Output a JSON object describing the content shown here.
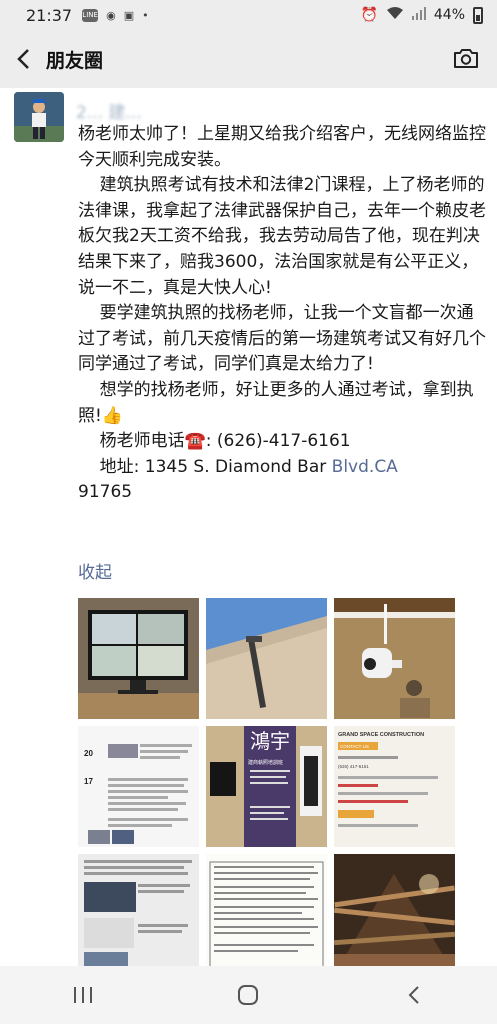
{
  "status_bar": {
    "time": "21:37",
    "notif_badge": "LINE",
    "battery": "44%"
  },
  "nav": {
    "title": "朋友圈"
  },
  "post": {
    "author": "2... 建...",
    "paragraphs": [
      "杨老师太帅了！上星期又给我介绍客户，无线网络监控今天顺利完成安装。",
      "    建筑执照考试有技术和法律2门课程，上了杨老师的法律课，我拿起了法律武器保护自己，去年一个赖皮老板欠我2天工资不给我，我去劳动局告了他，现在判决结果下来了，赔我3600，法治国家就是有公平正义，说一不二，真是大快人心!",
      "    要学建筑执照的找杨老师，让我一个文盲都一次通过了考试，前几天疫情后的第一场建筑考试又有好几个同学通过了考试，同学们真是太给力了!",
      "    想学的找杨老师，好让更多的人通过考试，拿到执照!👍"
    ],
    "phone_line": "    杨老师电话☎️: (626)-417-6161",
    "address_prefix": "    地址: 1345 S. Diamond Bar ",
    "address_link": "Blvd.CA",
    "address_suffix": "91765",
    "collapse_label": "收起"
  },
  "photos": [
    {
      "name": "monitor-cctv-photo"
    },
    {
      "name": "roof-gutter-photo"
    },
    {
      "name": "security-camera-photo"
    },
    {
      "name": "chat-screenshot-photo"
    },
    {
      "name": "school-banner-photo"
    },
    {
      "name": "business-card-photo"
    },
    {
      "name": "paper-documents-photo"
    },
    {
      "name": "exam-document-photo"
    },
    {
      "name": "attic-beams-photo"
    }
  ],
  "thumb_texts": {
    "banner_chars": "鴻宇",
    "banner_sub": "建商執照培訓班",
    "card_title": "GRAND SPACE CONSTRUCTION",
    "card_contact": "CONTACT US",
    "card_phone": "(626) 417-6161",
    "chat_date1": "20",
    "chat_date2": "17"
  }
}
